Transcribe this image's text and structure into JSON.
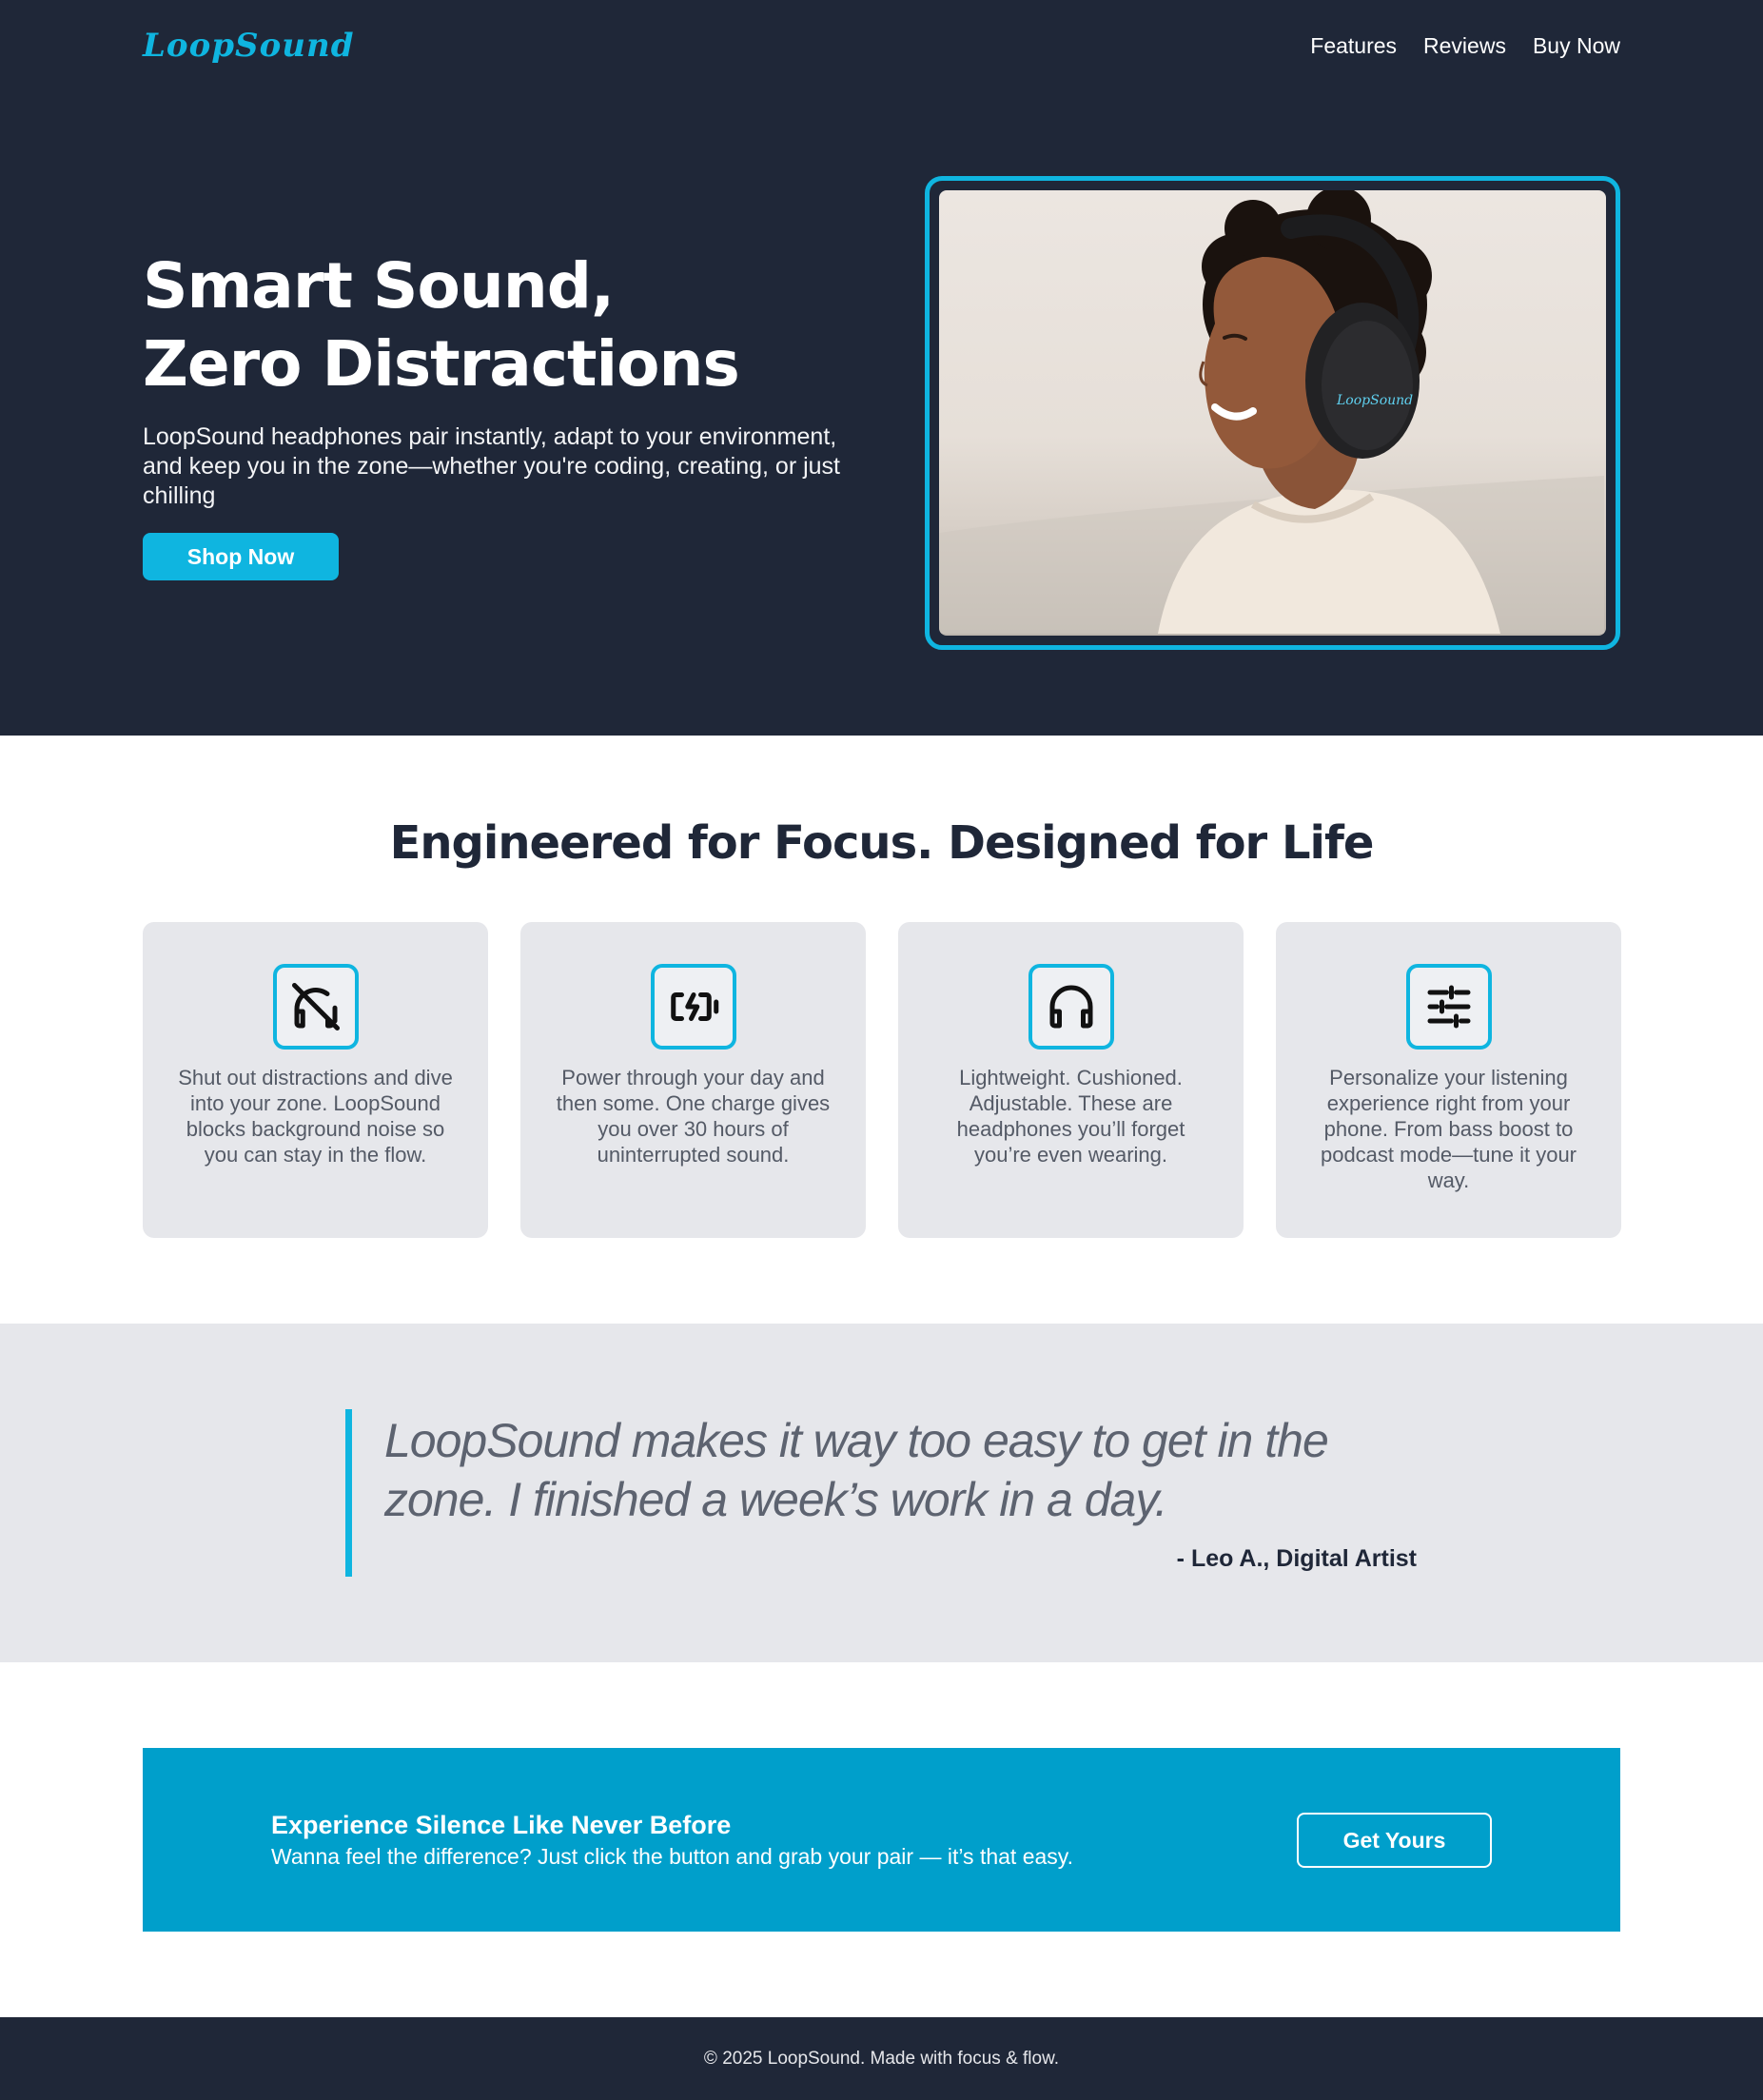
{
  "header": {
    "logo": "LoopSound",
    "nav": [
      "Features",
      "Reviews",
      "Buy Now"
    ]
  },
  "hero": {
    "title_line1": "Smart Sound,",
    "title_line2": "Zero Distractions",
    "subtitle": "LoopSound headphones pair instantly, adapt to your environment, and keep you in the zone—whether you're coding, creating, or just chilling",
    "cta": "Shop Now",
    "image_headphone_logo": "LoopSound"
  },
  "features": {
    "title": "Engineered for Focus. Designed for Life",
    "cards": [
      {
        "icon": "headphones-off-icon",
        "text": "Shut out distractions and dive into your zone. LoopSound blocks background noise so you can stay in the flow."
      },
      {
        "icon": "battery-charging-icon",
        "text": "Power through your day and then some. One charge gives you over 30 hours of uninterrupted sound."
      },
      {
        "icon": "headphones-icon",
        "text": "Lightweight. Cushioned. Adjustable. These are headphones you’ll forget you’re even wearing."
      },
      {
        "icon": "sliders-icon",
        "text": "Personalize your listening experience right from your phone. From bass boost to podcast mode—tune it your way."
      }
    ]
  },
  "testimonial": {
    "quote": "LoopSound makes it way too easy to get in the zone. I finished a week’s work in a day.",
    "author": "- Leo A., Digital Artist"
  },
  "cta": {
    "title": "Experience Silence Like Never Before",
    "subtitle": "Wanna feel the difference? Just click the button and grab your pair — it’s that easy.",
    "button": "Get Yours"
  },
  "footer": {
    "text": "© 2025 LoopSound. Made with focus & flow."
  },
  "colors": {
    "navy": "#1f2738",
    "accent": "#0fb5e0",
    "cta_bg": "#009fcb",
    "light_gray": "#e6e7eb"
  }
}
